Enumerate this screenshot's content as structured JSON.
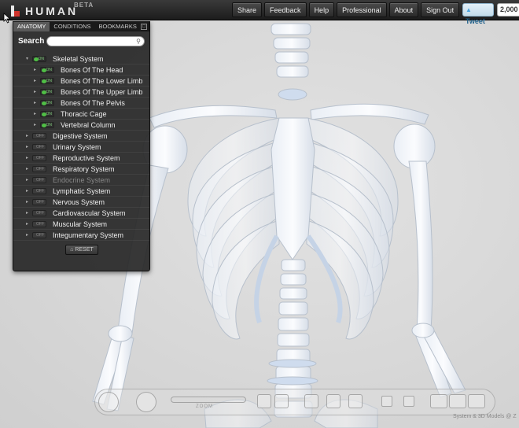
{
  "app": {
    "logo_text": "HUMAN",
    "beta_label": "BETA"
  },
  "nav": {
    "items": [
      "Share",
      "Feedback",
      "Help",
      "Professional",
      "About",
      "Sign Out"
    ]
  },
  "tweet": {
    "label": "Tweet",
    "count": "2,000"
  },
  "panel": {
    "tabs": [
      "ANATOMY",
      "CONDITIONS",
      "BOOKMARKS"
    ],
    "active_tab": "ANATOMY",
    "search_label": "Search",
    "search_value": "",
    "systems": [
      {
        "label": "Skeletal System",
        "state": "ON",
        "expanded": true
      },
      {
        "label": "Bones Of The Head",
        "state": "ON",
        "child": true
      },
      {
        "label": "Bones Of The Lower Limb",
        "state": "ON",
        "child": true
      },
      {
        "label": "Bones Of The Upper Limb",
        "state": "ON",
        "child": true
      },
      {
        "label": "Bones Of The Pelvis",
        "state": "ON",
        "child": true
      },
      {
        "label": "Thoracic Cage",
        "state": "ON",
        "child": true
      },
      {
        "label": "Vertebral Column",
        "state": "ON",
        "child": true
      },
      {
        "label": "Digestive System",
        "state": "OFF"
      },
      {
        "label": "Urinary System",
        "state": "OFF"
      },
      {
        "label": "Reproductive System",
        "state": "OFF"
      },
      {
        "label": "Respiratory System",
        "state": "OFF"
      },
      {
        "label": "Endocrine System",
        "state": "OFF",
        "disabled": true
      },
      {
        "label": "Lymphatic System",
        "state": "OFF"
      },
      {
        "label": "Nervous System",
        "state": "OFF"
      },
      {
        "label": "Cardiovascular System",
        "state": "OFF"
      },
      {
        "label": "Muscular System",
        "state": "OFF"
      },
      {
        "label": "Integumentary System",
        "state": "OFF"
      }
    ],
    "reset_label": "RESET"
  },
  "toolbar": {
    "zoom_label": "ZOOM"
  },
  "credit": "System & 3D Models @ Z"
}
